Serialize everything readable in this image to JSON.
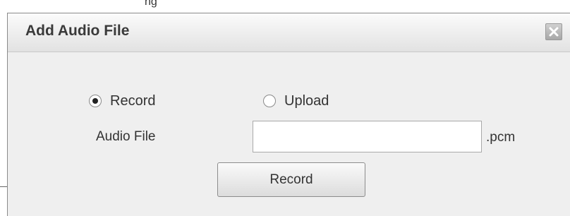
{
  "background_caption": "ng",
  "dialog": {
    "title": "Add Audio File",
    "close_icon": "close-icon"
  },
  "mode": {
    "options": [
      {
        "label": "Record",
        "selected": true
      },
      {
        "label": "Upload",
        "selected": false
      }
    ]
  },
  "audio_file": {
    "label": "Audio File",
    "value": "",
    "suffix": ".pcm"
  },
  "actions": {
    "record_label": "Record"
  }
}
